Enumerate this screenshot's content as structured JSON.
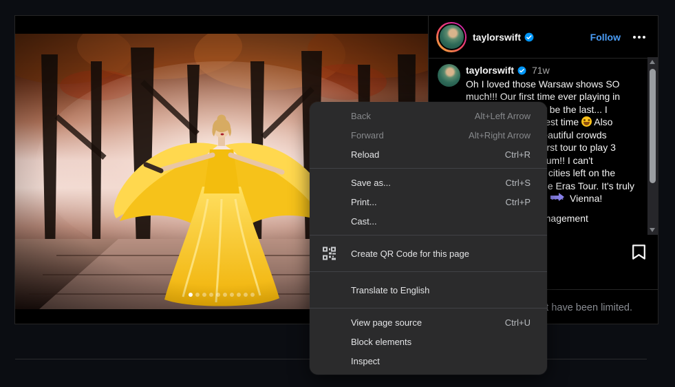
{
  "page": {
    "background": "#0b0d12"
  },
  "post": {
    "header": {
      "username": "taylorswift",
      "verified": true,
      "follow_label": "Follow",
      "icons": {
        "more_options": "three-dots-horizontal",
        "story_ring": "instagram-gradient-ring"
      }
    },
    "comment": {
      "username": "taylorswift",
      "verified": true,
      "timestamp": "71w",
      "lines": [
        "Oh I loved those Warsaw shows SO",
        "much!!! Our first time ever playing in",
        "Poland and it won't be the last... I",
        "had the absolute best time {smile} Also",
        "thank you to the beautiful crowds",
        "who made us the first tour to play 3",
        "nights in your stadium!! I can't",
        "believe there are 2 cities left on the",
        "European leg of The Eras Tour. It's truly",
        "flown by. Next stop {soon} Vienna!"
      ],
      "credit_line": "{camera}: TAS Rights Management"
    },
    "carousel": {
      "count": 10,
      "active_index": 0
    },
    "actions": {
      "bookmark_icon": "bookmark-outline"
    },
    "limited_notice": "Comments on this post have been limited.",
    "accent_colors": {
      "follow_blue": "#4a9cf5",
      "verified_blue": "#0095f6",
      "timestamp_gray": "#a8a8a8"
    }
  },
  "context_menu": {
    "items": [
      {
        "label": "Back",
        "shortcut": "Alt+Left Arrow",
        "disabled": true
      },
      {
        "label": "Forward",
        "shortcut": "Alt+Right Arrow",
        "disabled": true
      },
      {
        "label": "Reload",
        "shortcut": "Ctrl+R"
      },
      {
        "type": "separator"
      },
      {
        "label": "Save as...",
        "shortcut": "Ctrl+S"
      },
      {
        "label": "Print...",
        "shortcut": "Ctrl+P"
      },
      {
        "label": "Cast..."
      },
      {
        "type": "separator"
      },
      {
        "label": "Create QR Code for this page",
        "icon": "qr-code-icon",
        "tall": true
      },
      {
        "type": "separator"
      },
      {
        "label": "Translate to English",
        "tall": true
      },
      {
        "type": "separator"
      },
      {
        "label": "View page source",
        "shortcut": "Ctrl+U"
      },
      {
        "label": "Block elements"
      },
      {
        "label": "Inspect"
      }
    ],
    "colors": {
      "background": "#2b2b2c",
      "text": "#e4e5e7",
      "disabled_text": "#87898c",
      "separator": "#414246"
    }
  }
}
